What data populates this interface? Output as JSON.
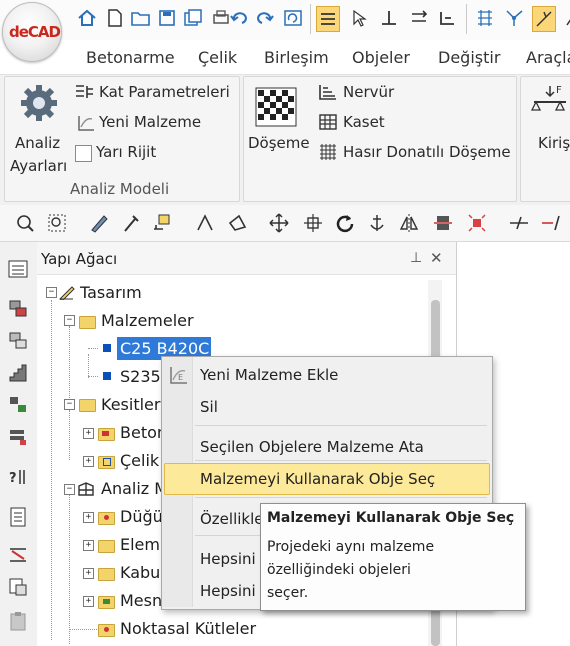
{
  "app": {
    "logo_text": "deCAD"
  },
  "menu_tabs": [
    "Betonarme",
    "Çelik",
    "Birleşim",
    "Objeler",
    "Değiştir",
    "Araçla"
  ],
  "ribbon": {
    "analiz_ayarlari": [
      "Analiz",
      "Ayarları"
    ],
    "kat_parametreleri": "Kat Parametreleri",
    "yeni_malzeme": "Yeni Malzeme",
    "yari_rijit": "Yarı Rijit",
    "group_analiz_modeli": "Analiz Modeli",
    "doseme": "Döşeme",
    "nervur": "Nervür",
    "kaset": "Kaset",
    "hasir": "Hasır Donatılı Döşeme",
    "kiris": "Kiriş"
  },
  "panel": {
    "title": "Yapı Ağacı",
    "pin_glyph": "⊥",
    "close_glyph": "✕"
  },
  "tree": {
    "tasarim": "Tasarım",
    "malzemeler": "Malzemeler",
    "mat1": "C25 B420C",
    "mat2": "S235",
    "kesitler": "Kesitler",
    "beton": "Beton",
    "celik": "Çelik",
    "analiz": "Analiz M",
    "dugum": "Düğü",
    "eleman": "Elema",
    "kabuk": "Kabu",
    "mesnet": "Mesn",
    "noktasal": "Noktasal Kütleler"
  },
  "context_menu": {
    "items": [
      "Yeni Malzeme Ekle",
      "Sil",
      "Seçilen Objelere Malzeme Ata",
      "Malzemeyi Kullanarak Obje Seç",
      "Özellikle",
      "Hepsini",
      "Hepsini"
    ],
    "highlight_color": "#fde99a"
  },
  "tooltip": {
    "title": "Malzemeyi Kullanarak Obje Seç",
    "lines": [
      "Projedeki aynı malzeme",
      "özelliğindeki objeleri",
      "seçer."
    ]
  },
  "colors": {
    "accent_blue": "#0a64c8",
    "selection": "#2f7ad9"
  }
}
